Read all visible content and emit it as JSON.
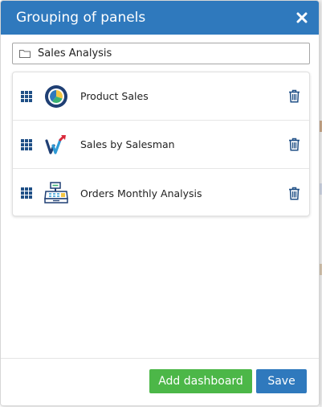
{
  "dialog": {
    "title": "Grouping of panels",
    "close_icon": "close-icon"
  },
  "group_name": {
    "icon": "folder-icon",
    "value": "Sales Analysis"
  },
  "panels": [
    {
      "label": "Product Sales",
      "icon": "pie-chart-icon"
    },
    {
      "label": "Sales by Salesman",
      "icon": "salesman-w-logo-icon"
    },
    {
      "label": "Orders Monthly Analysis",
      "icon": "cash-register-icon"
    }
  ],
  "footer": {
    "add_label": "Add dashboard",
    "save_label": "Save"
  },
  "colors": {
    "header": "#2f79bd",
    "add_button": "#4cb748",
    "save_button": "#2f79bd",
    "icon_dark": "#1f4f86"
  }
}
